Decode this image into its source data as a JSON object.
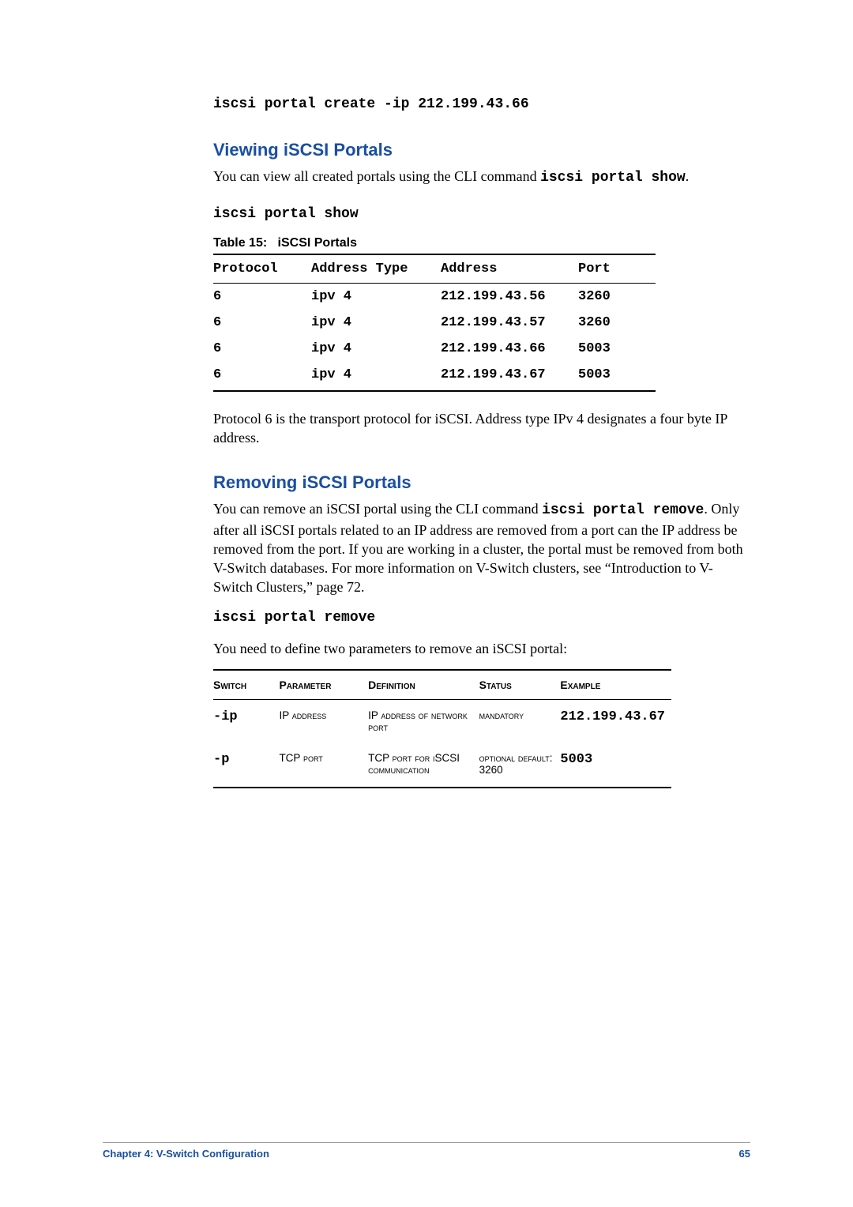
{
  "top_command": "iscsi portal create -ip 212.199.43.66",
  "section_view": {
    "heading": "Viewing iSCSI Portals",
    "p1_a": "You can view all created portals using the CLI command ",
    "p1_cmd": "iscsi portal show",
    "p1_b": ".",
    "command": "iscsi portal show",
    "table_caption_a": "Table  15:",
    "table_caption_b": "iSCSI Portals",
    "table": {
      "headers": [
        "Protocol",
        "Address Type",
        "Address",
        "Port"
      ],
      "rows": [
        [
          "6",
          "ipv 4",
          "212.199.43.56",
          "3260"
        ],
        [
          "6",
          "ipv 4",
          "212.199.43.57",
          "3260"
        ],
        [
          "6",
          "ipv 4",
          "212.199.43.66",
          "5003"
        ],
        [
          "6",
          "ipv 4",
          "212.199.43.67",
          "5003"
        ]
      ]
    },
    "note": "Protocol 6 is the transport protocol for iSCSI.  Address type IPv 4 designates a four byte IP address."
  },
  "section_remove": {
    "heading": "Removing iSCSI Portals",
    "p1_a": "You can remove an iSCSI portal using the CLI command ",
    "p1_cmd": "iscsi portal remove",
    "p1_b": ".  Only after all iSCSI portals related to an IP address are removed from a port can the IP address be removed from the port.  If you are working in a cluster, the portal must be removed from both V-Switch databases.  For more information on V-Switch clusters, see “Introduction to V-Switch Clusters,” page 72.",
    "command": "iscsi portal remove",
    "p2": "You need to define two parameters to remove an iSCSI portal:",
    "params": {
      "headers": [
        "Switch",
        "Parameter",
        "Definition",
        "Status",
        "Example"
      ],
      "rows": [
        {
          "switch": "-ip",
          "param": "IP address",
          "def": "IP address of network port",
          "status": "mandatory",
          "example": "212.199.43.67"
        },
        {
          "switch": "-p",
          "param": "TCP port",
          "def": "TCP port for iSCSI communication",
          "status": "optional default: 3260",
          "example": "5003"
        }
      ]
    }
  },
  "footer": {
    "left": "Chapter 4:  V-Switch Configuration",
    "right": "65"
  }
}
